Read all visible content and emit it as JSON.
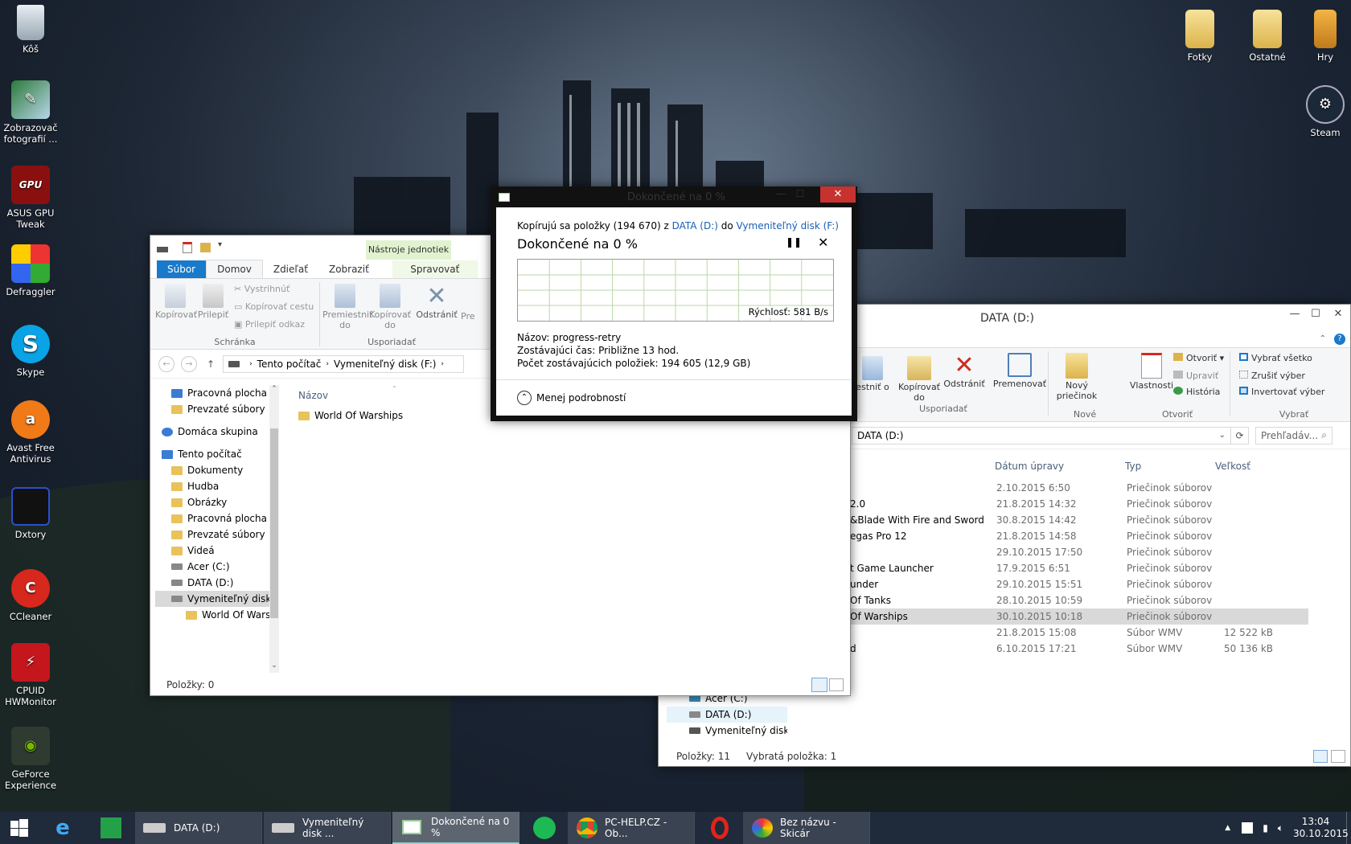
{
  "colors": {
    "accent": "#1979ca",
    "close": "#c7322f",
    "tool_tab": "#e0f2cf",
    "graph_grid": "#b9d7a4"
  },
  "desktop": {
    "left_icons": [
      {
        "label": "Kôš",
        "icon": "recycle-bin-icon"
      },
      {
        "label": "Zobrazovač fotografií ...",
        "icon": "photo-viewer-icon"
      },
      {
        "label": "ASUS GPU Tweak",
        "icon": "asus-gpu-tweak-icon"
      },
      {
        "label": "Defraggler",
        "icon": "defraggler-icon"
      },
      {
        "label": "Skype",
        "icon": "skype-icon"
      },
      {
        "label": "Avast Free Antivirus",
        "icon": "avast-icon"
      },
      {
        "label": "Dxtory",
        "icon": "dxtory-icon"
      },
      {
        "label": "CCleaner",
        "icon": "ccleaner-icon"
      },
      {
        "label": "CPUID HWMonitor",
        "icon": "hwmonitor-icon"
      },
      {
        "label": "GeForce Experience",
        "icon": "geforce-icon"
      }
    ],
    "right_icons": [
      {
        "label": "Fotky",
        "icon": "folder-icon"
      },
      {
        "label": "Ostatné",
        "icon": "folder-icon"
      },
      {
        "label": "Hry",
        "icon": "phone-icon"
      },
      {
        "label": "Steam",
        "icon": "steam-icon"
      }
    ]
  },
  "explorer_f": {
    "tool_tab": "Nástroje jednotiek",
    "tabs": [
      "Súbor",
      "Domov",
      "Zdieľať",
      "Zobraziť",
      "Spravovať"
    ],
    "clipboard": {
      "copy": "Kopírovať",
      "paste": "Prilepiť",
      "cut": "Vystrihnúť",
      "copy_path": "Kopírovať cestu",
      "paste_link": "Prilepiť odkaz",
      "group": "Schránka"
    },
    "organize": {
      "move": "Premiestniť do",
      "copy": "Kopírovať do",
      "delete": "Odstrániť",
      "rename": "Pre",
      "group": "Usporiadať"
    },
    "path": [
      "Tento počítač",
      "Vymeniteľný disk (F:)"
    ],
    "tree": [
      {
        "label": "Pracovná plocha",
        "type": "blue"
      },
      {
        "label": "Prevzaté súbory",
        "type": "folder"
      },
      {
        "label": "Domáca skupina",
        "type": "group"
      },
      {
        "label": "Tento počítač",
        "type": "pc"
      },
      {
        "label": "Dokumenty",
        "type": "folder"
      },
      {
        "label": "Hudba",
        "type": "folder"
      },
      {
        "label": "Obrázky",
        "type": "folder"
      },
      {
        "label": "Pracovná plocha",
        "type": "folder"
      },
      {
        "label": "Prevzaté súbory",
        "type": "folder"
      },
      {
        "label": "Videá",
        "type": "folder"
      },
      {
        "label": "Acer (C:)",
        "type": "drive"
      },
      {
        "label": "DATA (D:)",
        "type": "drive"
      },
      {
        "label": "Vymeniteľný disk",
        "type": "drive"
      },
      {
        "label": "World Of Warsl",
        "type": "folder"
      }
    ],
    "column_name": "Názov",
    "files": [
      "World Of Warships"
    ],
    "status": "Položky: 0"
  },
  "explorer_d": {
    "title": "DATA (D:)",
    "ribbon": {
      "move": "estniť o",
      "copy": "Kopírovať do",
      "delete": "Odstrániť",
      "rename": "Premenovať",
      "new_folder": "Nový priečinok",
      "properties": "Vlastnosti",
      "open": "Otvoriť",
      "edit": "Upraviť",
      "history": "História",
      "select_all": "Vybrať všetko",
      "select_none": "Zrušiť výber",
      "invert": "Invertovať výber",
      "g_organize": "Usporiadať",
      "g_new": "Nové",
      "g_open": "Otvoriť",
      "g_select": "Vybrať"
    },
    "path": "DATA (D:)",
    "search_placeholder": "Prehľadáv...",
    "columns": [
      "Dátum úpravy",
      "Typ",
      "Veľkosť"
    ],
    "rows": [
      {
        "name": "",
        "date": "2.10.2015 6:50",
        "type": "Priečinok súborov",
        "size": ""
      },
      {
        "name": "2.0",
        "date": "21.8.2015 14:32",
        "type": "Priečinok súborov",
        "size": ""
      },
      {
        "name": "&Blade With Fire and Sword",
        "date": "30.8.2015 14:42",
        "type": "Priečinok súborov",
        "size": ""
      },
      {
        "name": "egas Pro 12",
        "date": "21.8.2015 14:58",
        "type": "Priečinok súborov",
        "size": ""
      },
      {
        "name": "",
        "date": "29.10.2015 17:50",
        "type": "Priečinok súborov",
        "size": ""
      },
      {
        "name": "t Game Launcher",
        "date": "17.9.2015 6:51",
        "type": "Priečinok súborov",
        "size": ""
      },
      {
        "name": "under",
        "date": "29.10.2015 15:51",
        "type": "Priečinok súborov",
        "size": ""
      },
      {
        "name": "Of Tanks",
        "date": "28.10.2015 10:59",
        "type": "Priečinok súborov",
        "size": ""
      },
      {
        "name": "Of Warships",
        "date": "30.10.2015 10:18",
        "type": "Priečinok súborov",
        "size": ""
      },
      {
        "name": "",
        "date": "21.8.2015 15:08",
        "type": "Súbor WMV",
        "size": "12 522 kB"
      },
      {
        "name": "d",
        "date": "6.10.2015 17:21",
        "type": "Súbor WMV",
        "size": "50 136 kB"
      }
    ],
    "tree": [
      "Acer (C:)",
      "DATA (D:)",
      "Vymeniteľný disk"
    ],
    "status_items": "Položky: 11",
    "status_selected": "Vybratá položka: 1"
  },
  "copy_dialog": {
    "title": "Dokončené na 0 %",
    "line_prefix": "Kopírujú sa položky (194 670) z ",
    "source": "DATA (D:)",
    "line_mid": " do ",
    "dest": "Vymeniteľný disk (F:)",
    "heading": "Dokončené na 0 %",
    "progress": 0,
    "speed": "Rýchlosť: 581 B/s",
    "name_label": "Názov:",
    "name_value": "progress-retry",
    "time_label": "Zostávajúci čas:",
    "time_value": "Približne 13 hod.",
    "count_label": "Počet zostávajúcich položiek:",
    "count_value": "194 605 (12,9 GB)",
    "less_details": "Menej podrobností"
  },
  "taskbar": {
    "items": [
      {
        "label": "DATA (D:)",
        "icon": "drive-icon"
      },
      {
        "label": "Vymeniteľný disk ...",
        "icon": "drive-icon"
      },
      {
        "label": "Dokončené na 0 %",
        "icon": "copy-icon"
      },
      {
        "label": "PC-HELP.CZ - Ob...",
        "icon": "chrome-icon"
      },
      {
        "label": "Bez názvu - Skicár",
        "icon": "paint-icon"
      }
    ],
    "time": "13:04",
    "date": "30.10.2015"
  }
}
